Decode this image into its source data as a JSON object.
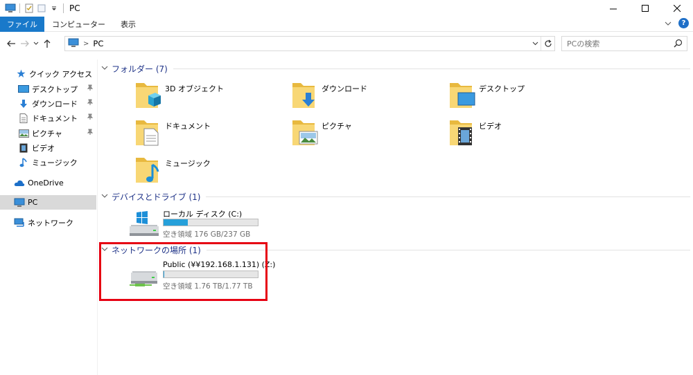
{
  "window": {
    "title": "PC"
  },
  "ribbon": {
    "tabs": [
      "ファイル",
      "コンピューター",
      "表示"
    ],
    "help": "?"
  },
  "address": {
    "path": "PC"
  },
  "search": {
    "placeholder": "PCの検索"
  },
  "sidebar": {
    "items": [
      {
        "label": "クイック アクセス",
        "icon": "star-icon"
      },
      {
        "label": "デスクトップ",
        "icon": "desktop-icon",
        "pinned": true
      },
      {
        "label": "ダウンロード",
        "icon": "download-icon",
        "pinned": true
      },
      {
        "label": "ドキュメント",
        "icon": "document-icon",
        "pinned": true
      },
      {
        "label": "ピクチャ",
        "icon": "picture-icon",
        "pinned": true
      },
      {
        "label": "ビデオ",
        "icon": "video-icon"
      },
      {
        "label": "ミュージック",
        "icon": "music-icon"
      },
      {
        "label": "OneDrive",
        "icon": "cloud-icon"
      },
      {
        "label": "PC",
        "icon": "pc-icon",
        "selected": true
      },
      {
        "label": "ネットワーク",
        "icon": "network-icon"
      }
    ]
  },
  "groups": {
    "folders": {
      "title": "フォルダー (7)",
      "items": [
        {
          "label": "3D オブジェクト",
          "icon": "3d-objects-folder-icon"
        },
        {
          "label": "ダウンロード",
          "icon": "downloads-folder-icon"
        },
        {
          "label": "デスクトップ",
          "icon": "desktop-folder-icon"
        },
        {
          "label": "ドキュメント",
          "icon": "documents-folder-icon"
        },
        {
          "label": "ピクチャ",
          "icon": "pictures-folder-icon"
        },
        {
          "label": "ビデオ",
          "icon": "videos-folder-icon"
        },
        {
          "label": "ミュージック",
          "icon": "music-folder-icon"
        }
      ]
    },
    "devices": {
      "title": "デバイスとドライブ (1)",
      "items": [
        {
          "name": "ローカル ディスク (C:)",
          "free": "空き領域 176 GB/237 GB",
          "used_fraction": 0.26,
          "icon": "local-disk-icon"
        }
      ]
    },
    "network": {
      "title": "ネットワークの場所 (1)",
      "items": [
        {
          "name": "Public (¥¥192.168.1.131) (Z:)",
          "free": "空き領域 1.76 TB/1.77 TB",
          "used_fraction": 0.006,
          "icon": "network-drive-icon"
        }
      ]
    }
  },
  "colors": {
    "accent": "#1979ca",
    "group_title": "#1e3287",
    "usage_bar": "#26a0da",
    "highlight": "#e60012",
    "folder_yellow": "#f8d775"
  }
}
